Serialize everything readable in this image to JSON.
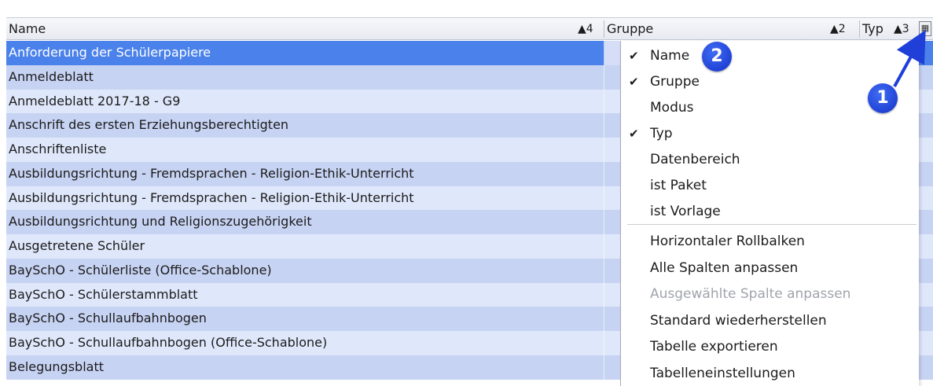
{
  "header": {
    "name_label": "Name",
    "name_sort": "▲4",
    "gruppe_label": "Gruppe",
    "gruppe_sort": "▲2",
    "typ_label": "Typ",
    "typ_sort": "▲3",
    "column_chooser_icon": "column-chooser-icon"
  },
  "rows": [
    "Anforderung der Schülerpapiere",
    "Anmeldeblatt",
    "Anmeldeblatt 2017-18 - G9",
    "Anschrift des ersten Erziehungsberechtigten",
    "Anschriftenliste",
    "Ausbildungsrichtung - Fremdsprachen - Religion-Ethik-Unterricht",
    "Ausbildungsrichtung - Fremdsprachen - Religion-Ethik-Unterricht",
    "Ausbildungsrichtung und Religionszugehörigkeit",
    "Ausgetretene Schüler",
    "BaySchO - Schülerliste (Office-Schablone)",
    "BaySchO - Schülerstammblatt",
    "BaySchO - Schullaufbahnbogen",
    "BaySchO - Schullaufbahnbogen (Office-Schablone)",
    "Belegungsblatt"
  ],
  "selected_row": 0,
  "menu": {
    "columns": [
      {
        "label": "Name",
        "checked": true
      },
      {
        "label": "Gruppe",
        "checked": true
      },
      {
        "label": "Modus",
        "checked": false
      },
      {
        "label": "Typ",
        "checked": true
      },
      {
        "label": "Datenbereich",
        "checked": false
      },
      {
        "label": "ist Paket",
        "checked": false
      },
      {
        "label": "ist Vorlage",
        "checked": false
      }
    ],
    "actions": [
      {
        "label": "Horizontaler Rollbalken",
        "enabled": true
      },
      {
        "label": "Alle Spalten anpassen",
        "enabled": true
      },
      {
        "label": "Ausgewählte Spalte anpassen",
        "enabled": false
      },
      {
        "label": "Standard wiederherstellen",
        "enabled": true
      },
      {
        "label": "Tabelle exportieren",
        "enabled": true
      },
      {
        "label": "Tabelleneinstellungen",
        "enabled": true
      }
    ]
  },
  "annotations": {
    "badge_1": "1",
    "badge_2": "2"
  },
  "colors": {
    "selected_row": "#4a81ea",
    "row_odd": "#c7d3f3",
    "row_even": "#dfe7fb",
    "badge": "#1f3fd8"
  }
}
